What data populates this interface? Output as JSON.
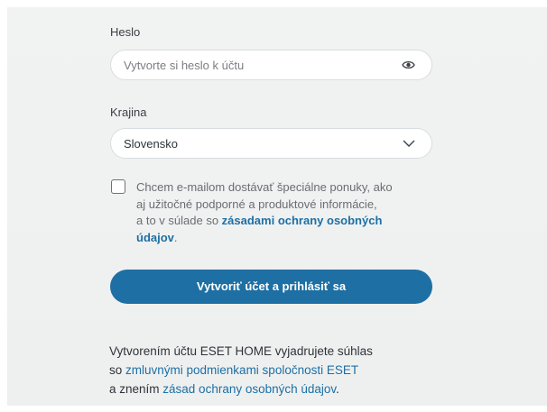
{
  "password": {
    "label": "Heslo",
    "placeholder": "Vytvorte si heslo k účtu"
  },
  "country": {
    "label": "Krajina",
    "selected": "Slovensko"
  },
  "consent": {
    "line1": "Chcem e-mailom dostávať špeciálne ponuky, ako",
    "line2": "aj užitočné podporné a produktové informácie,",
    "line3_text": "a to v súlade so ",
    "line3_link": "zásadami ochrany osobných",
    "line4_link": "údajov",
    "line4_end": "."
  },
  "submit": {
    "label": "Vytvoriť účet a prihlásiť sa"
  },
  "terms": {
    "line1": "Vytvorením účtu ESET HOME vyjadrujete súhlas",
    "line2_text": "so ",
    "line2_link": "zmluvnými podmienkami spoločnosti ESET",
    "line3_text": "a znením ",
    "line3_link": "zásad ochrany osobných údajov",
    "line3_end": "."
  },
  "icons": {
    "password_toggle": "eye-icon",
    "dropdown": "chevron-down-icon"
  },
  "colors": {
    "accent": "#1e6fa3",
    "link": "#1d6fa4",
    "background": "#f0f1f1"
  }
}
